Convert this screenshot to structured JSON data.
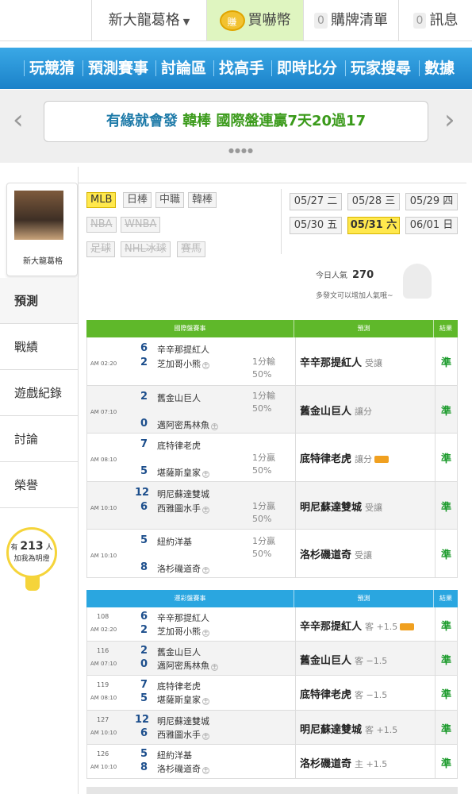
{
  "topbar": {
    "user_name": "新大龍葛格",
    "coin_icon_text": "賺",
    "buy_coins": "買嚇幣",
    "cart_count": "0",
    "cart_label": "購牌清單",
    "msg_count": "0",
    "msg_label": "訊息"
  },
  "nav": {
    "items": [
      "玩競猜",
      "預測賽事",
      "討論區",
      "找高手",
      "即時比分",
      "玩家搜尋",
      "數據"
    ]
  },
  "banner": {
    "prefix": "有緣就會發",
    "highlight": "韓棒",
    "suffix": "國際盤連贏7天20過17"
  },
  "profile": {
    "name": "新大龍葛格"
  },
  "side_menu": {
    "items": [
      "預測",
      "戰績",
      "遊戲紀錄",
      "討論",
      "榮譽"
    ]
  },
  "fans": {
    "prefix": "有",
    "count": "213",
    "unit": "人",
    "label": "加我為明燈"
  },
  "sports": {
    "row1": [
      "MLB",
      "日棒",
      "中職",
      "韓棒"
    ],
    "row2": [
      "NBA",
      "WNBA"
    ],
    "row3": [
      "足球",
      "NHL冰球",
      "賽馬"
    ]
  },
  "dates": [
    "05/27 二",
    "05/28 三",
    "05/29 四",
    "05/30 五",
    "05/31 六",
    "06/01 日"
  ],
  "popularity": {
    "label": "今日人氣",
    "value": "270",
    "hint": "多發文可以增加人氣哦~"
  },
  "table1": {
    "headers": [
      "國際盤賽事",
      "預測",
      "結果"
    ],
    "rows": [
      {
        "time": "AM 02:20",
        "s1": "6",
        "t1": "辛辛那提紅人",
        "h1": false,
        "s2": "2",
        "t2": "芝加哥小熊",
        "h2": true,
        "line": "1分輸",
        "pct": "50%",
        "pick": "辛辛那提紅人",
        "pick_sub": "受讓",
        "badge": false,
        "result": "準"
      },
      {
        "time": "AM 07:10",
        "s1": "2",
        "t1": "舊金山巨人",
        "h1": false,
        "s2": "0",
        "t2": "邁阿密馬林魚",
        "h2": true,
        "line": "1分輸",
        "pct": "50%",
        "pick": "舊金山巨人",
        "pick_sub": "讓分",
        "badge": false,
        "result": "準"
      },
      {
        "time": "AM 08:10",
        "s1": "7",
        "t1": "底特律老虎",
        "h1": false,
        "s2": "5",
        "t2": "堪薩斯皇家",
        "h2": true,
        "line": "1分贏",
        "pct": "50%",
        "pick": "底特律老虎",
        "pick_sub": "讓分",
        "badge": true,
        "result": "準"
      },
      {
        "time": "AM 10:10",
        "s1": "12",
        "t1": "明尼蘇達雙城",
        "h1": false,
        "s2": "6",
        "t2": "西雅圖水手",
        "h2": true,
        "line": "1分贏",
        "pct": "50%",
        "pick": "明尼蘇達雙城",
        "pick_sub": "受讓",
        "badge": false,
        "result": "準"
      },
      {
        "time": "AM 10:10",
        "s1": "5",
        "t1": "紐約洋基",
        "h1": false,
        "s2": "8",
        "t2": "洛杉磯道奇",
        "h2": true,
        "line": "1分贏",
        "pct": "50%",
        "pick": "洛杉磯道奇",
        "pick_sub": "受讓",
        "badge": false,
        "result": "準"
      }
    ]
  },
  "table2": {
    "headers": [
      "運彩盤賽事",
      "預測",
      "結果"
    ],
    "rows": [
      {
        "no": "108",
        "time": "AM 02:20",
        "s1": "6",
        "t1": "辛辛那提紅人",
        "s2": "2",
        "t2": "芝加哥小熊",
        "pick": "辛辛那提紅人",
        "pick_sub": "客 +1.5",
        "badge": true,
        "result": "準"
      },
      {
        "no": "116",
        "time": "AM 07:10",
        "s1": "2",
        "t1": "舊金山巨人",
        "s2": "0",
        "t2": "邁阿密馬林魚",
        "pick": "舊金山巨人",
        "pick_sub": "客 −1.5",
        "badge": false,
        "result": "準"
      },
      {
        "no": "119",
        "time": "AM 08:10",
        "s1": "7",
        "t1": "底特律老虎",
        "s2": "5",
        "t2": "堪薩斯皇家",
        "pick": "底特律老虎",
        "pick_sub": "客 −1.5",
        "badge": false,
        "result": "準"
      },
      {
        "no": "127",
        "time": "AM 10:10",
        "s1": "12",
        "t1": "明尼蘇達雙城",
        "s2": "6",
        "t2": "西雅圖水手",
        "pick": "明尼蘇達雙城",
        "pick_sub": "客 +1.5",
        "badge": false,
        "result": "準"
      },
      {
        "no": "126",
        "time": "AM 10:10",
        "s1": "5",
        "t1": "紐約洋基",
        "s2": "8",
        "t2": "洛杉磯道奇",
        "pick": "洛杉磯道奇",
        "pick_sub": "主 +1.5",
        "badge": false,
        "result": "準"
      }
    ],
    "home_mark": "主"
  },
  "colors": {
    "nav_blue": "#1b82c9",
    "table1_header": "#5fb82a",
    "table2_header": "#2aa6e0",
    "result_green": "#1a9a2a",
    "active_yellow": "#ffe84d"
  }
}
